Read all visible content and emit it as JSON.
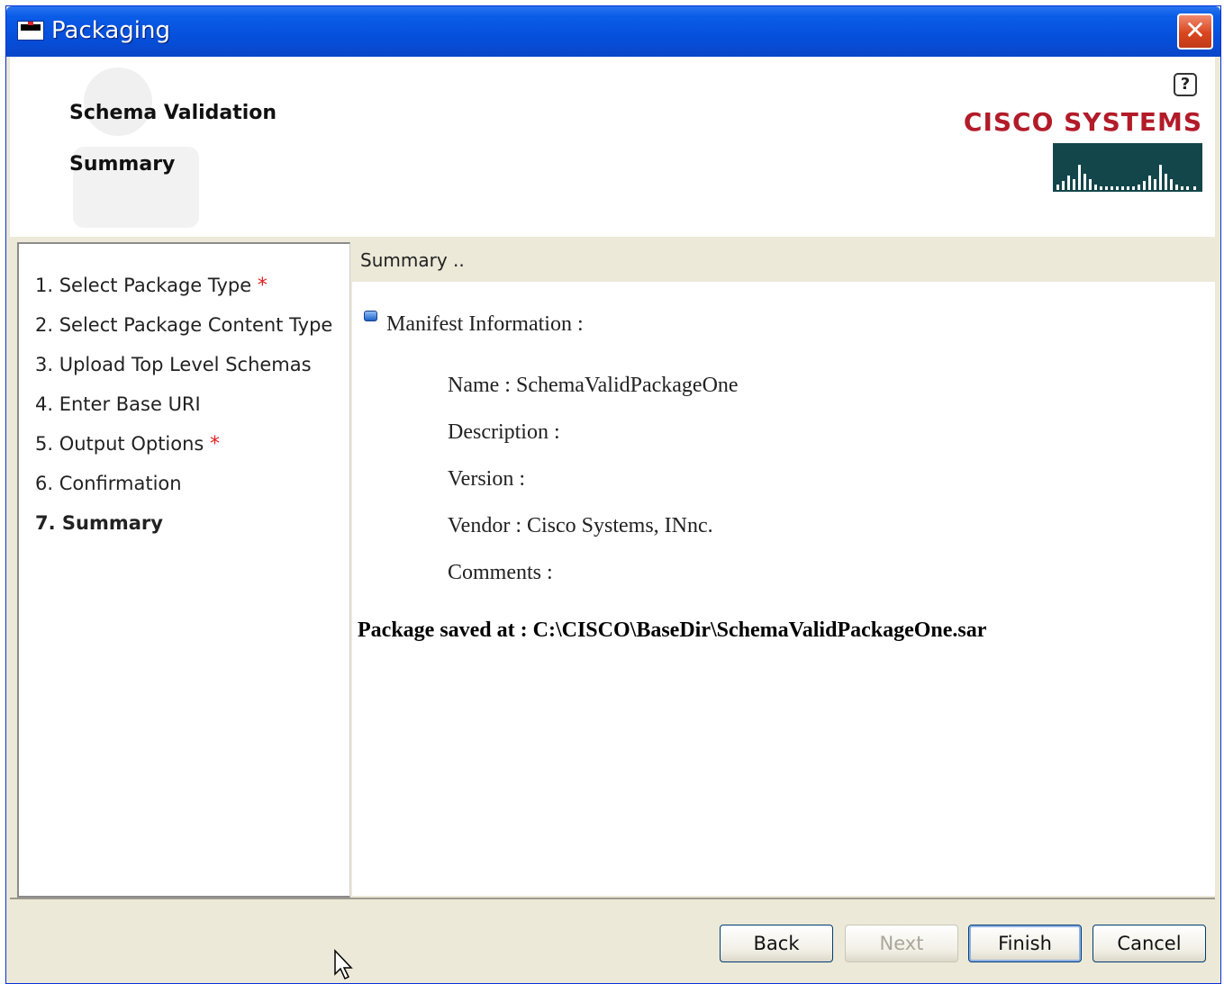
{
  "window": {
    "title": "Packaging",
    "close_label": "✕"
  },
  "header": {
    "steps_heading": [
      "Schema Validation",
      "Summary"
    ],
    "help_label": "?",
    "brand": "CISCO SYSTEMS"
  },
  "wizard_steps": [
    {
      "label": "1. Select Package Type",
      "required": true
    },
    {
      "label": "2. Select Package Content Type",
      "required": false
    },
    {
      "label": "3. Upload Top Level Schemas",
      "required": false
    },
    {
      "label": "4. Enter Base URI",
      "required": false
    },
    {
      "label": "5. Output Options",
      "required": true
    },
    {
      "label": "6. Confirmation",
      "required": false
    },
    {
      "label": "7. Summary",
      "required": false,
      "current": true
    }
  ],
  "required_marker": "*",
  "summary": {
    "heading": "Summary ..",
    "manifest_title": "Manifest Information :",
    "fields": [
      "Name : SchemaValidPackageOne",
      "Description :",
      "Version :",
      "Vendor : Cisco Systems, INnc.",
      "Comments :"
    ],
    "saved_message": "Package saved at : C:\\CISCO\\BaseDir\\SchemaValidPackageOne.sar"
  },
  "buttons": {
    "back": "Back",
    "next": "Next",
    "finish": "Finish",
    "cancel": "Cancel"
  },
  "colors": {
    "titlebar": "#0550dc",
    "cisco_red": "#b21b29",
    "cisco_logo_bg": "#13464a",
    "required": "#e02020"
  }
}
